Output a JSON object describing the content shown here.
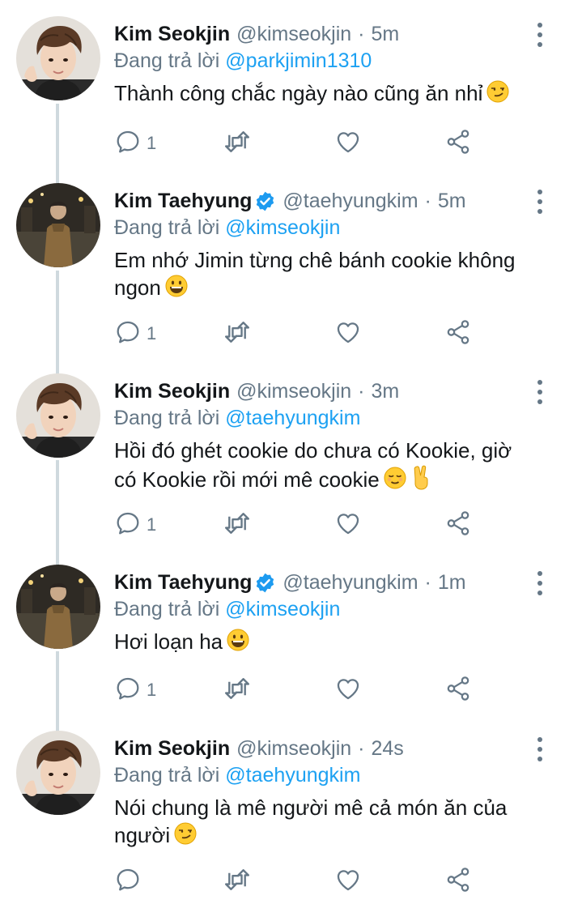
{
  "reply_prefix": "Đang trả lời",
  "tweets": [
    {
      "name": "Kim Seokjin",
      "verified": false,
      "handle": "@kimseokjin",
      "separator": "·",
      "time": "5m",
      "reply_to": "@parkjimin1310",
      "text_lines": [
        "Thành công chắc ngày nào cũng ăn nhỉ"
      ],
      "emoji": [
        "smirk-face"
      ],
      "reply_count": "1"
    },
    {
      "name": "Kim Taehyung",
      "verified": true,
      "handle": "@taehyungkim",
      "separator": "·",
      "time": "5m",
      "reply_to": "@kimseokjin",
      "text_lines": [
        "Em nhớ Jimin từng chê bánh cookie không",
        "ngon"
      ],
      "emoji": [
        "grinning-face"
      ],
      "reply_count": "1"
    },
    {
      "name": "Kim Seokjin",
      "verified": false,
      "handle": "@kimseokjin",
      "separator": "·",
      "time": "3m",
      "reply_to": "@taehyungkim",
      "text_lines": [
        "Hồi đó ghét cookie do chưa có Kookie, giờ",
        "có Kookie rồi mới mê cookie"
      ],
      "emoji": [
        "relieved-face",
        "victory-hand"
      ],
      "reply_count": "1"
    },
    {
      "name": "Kim Taehyung",
      "verified": true,
      "handle": "@taehyungkim",
      "separator": "·",
      "time": "1m",
      "reply_to": "@kimseokjin",
      "text_lines": [
        "Hơi loạn ha"
      ],
      "emoji": [
        "grinning-face"
      ],
      "reply_count": "1"
    },
    {
      "name": "Kim Seokjin",
      "verified": false,
      "handle": "@kimseokjin",
      "separator": "·",
      "time": "24s",
      "reply_to": "@taehyungkim",
      "text_lines": [
        "Nói chung là mê người mê cả món ăn của",
        "người"
      ],
      "emoji": [
        "smirk-face"
      ],
      "reply_count": ""
    }
  ],
  "icons": {
    "reply": "reply-icon",
    "retweet": "retweet-icon",
    "like": "heart-icon",
    "share": "share-icon",
    "more": "more-options-icon",
    "verified": "verified-badge-icon"
  },
  "colors": {
    "text": "#14171a",
    "secondary": "#657786",
    "link": "#1da1f2",
    "thread_line": "#cfd9de",
    "verified": "#1d9bf0"
  }
}
